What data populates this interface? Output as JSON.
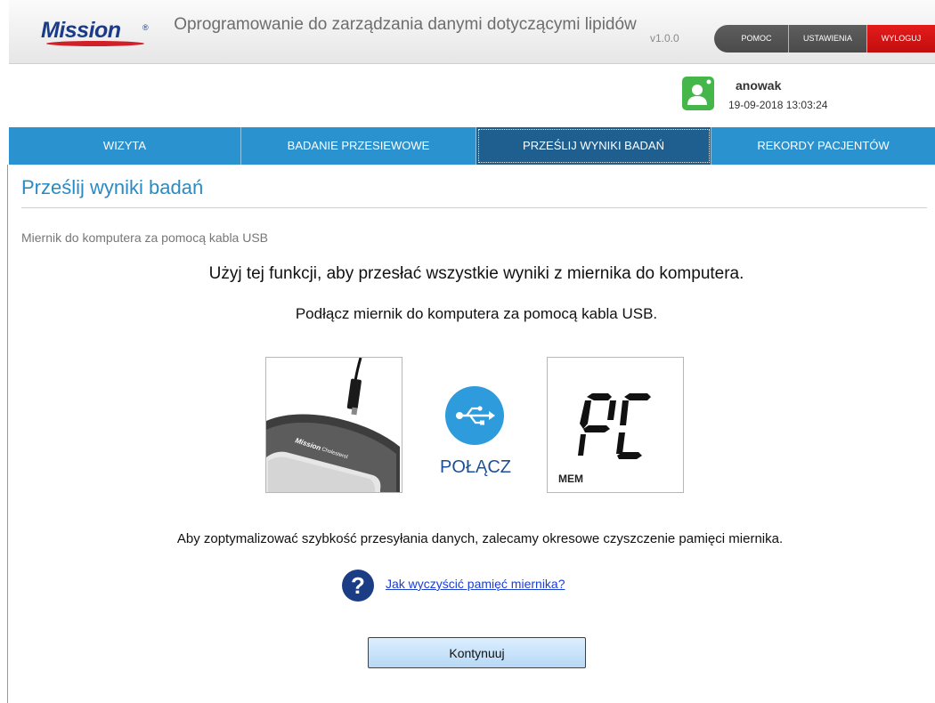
{
  "header": {
    "brand": "Mission",
    "brand_mark": "®",
    "app_title": "Oprogramowanie do zarządzania danymi dotyczącymi lipidów",
    "version": "v1.0.0",
    "top_nav": [
      "POMOC",
      "USTAWIENIA",
      "WYLOGUJ"
    ]
  },
  "user": {
    "name": "anowak",
    "datetime": "19-09-2018 13:03:24",
    "avatar_icon": "user-icon"
  },
  "main_nav": {
    "tabs": [
      "WIZYTA",
      "BADANIE PRZESIEWOWE",
      "PRZEŚLIJ WYNIKI BADAŃ",
      "REKORDY PACJENTÓW"
    ],
    "active": "PRZEŚLIJ WYNIKI BADAŃ"
  },
  "content": {
    "title": "Prześlij wyniki badań",
    "subtitle": "Miernik do komputera za pomocą kabla USB",
    "instruction_1": "Użyj tej funkcji, aby przesłać wszystkie wyniki z miernika do komputera.",
    "instruction_2": "Podłącz miernik do komputera za pomocą kabla USB.",
    "device_label": "Mission Cholesterol",
    "connect_label": "POŁĄCZ",
    "meter_display": "PC",
    "meter_mem": "MEM",
    "tip": "Aby zoptymalizować szybkość przesyłania danych, zalecamy okresowe czyszczenie pamięci miernika.",
    "help_link": "Jak wyczyścić pamięć miernika?",
    "continue_label": "Kontynuuj"
  },
  "colors": {
    "nav_blue": "#2a92cf",
    "nav_active": "#1e5f8f",
    "title_blue": "#2a8bc4",
    "logout_red": "#d4141a",
    "avatar_green": "#45b649",
    "usb_blue": "#2e9bdc",
    "help_navy": "#1b3d86"
  }
}
